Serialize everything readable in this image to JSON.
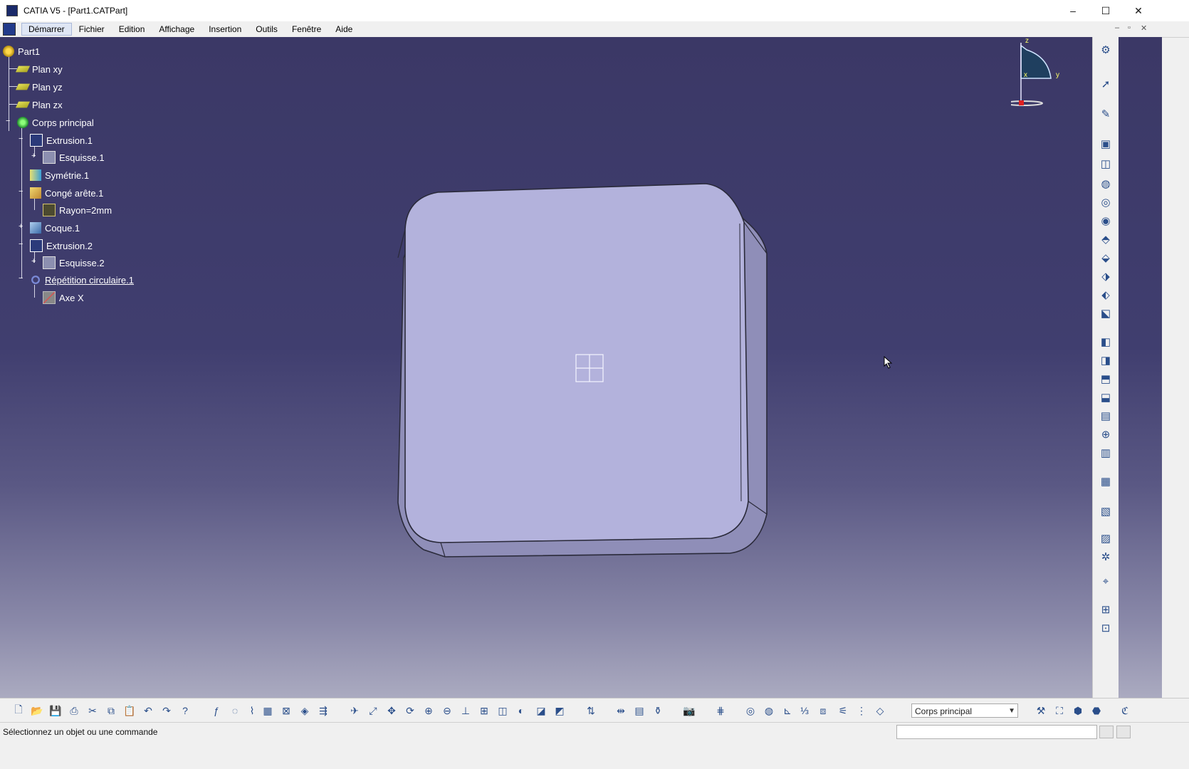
{
  "window": {
    "title": "CATIA V5 - [Part1.CATPart]",
    "minimize_icon": "minimize-icon",
    "maximize_icon": "maximize-icon",
    "close_icon": "close-icon"
  },
  "menu": {
    "items": [
      "Démarrer",
      "Fichier",
      "Edition",
      "Affichage",
      "Insertion",
      "Outils",
      "Fenêtre",
      "Aide"
    ],
    "active_index": 0
  },
  "tree": {
    "root": "Part1",
    "plane_xy": "Plan xy",
    "plane_yz": "Plan yz",
    "plane_zx": "Plan zx",
    "body": "Corps principal",
    "extrusion1": "Extrusion.1",
    "esquisse1": "Esquisse.1",
    "symetrie1": "Symétrie.1",
    "conge": "Congé arête.1",
    "rayon": "Rayon=2mm",
    "coque": "Coque.1",
    "extrusion2": "Extrusion.2",
    "esquisse2": "Esquisse.2",
    "repetition": "Répétition circulaire.1",
    "axe": "Axe X"
  },
  "compass": {
    "z": "z",
    "x": "x",
    "y": "y"
  },
  "mini_axis": {
    "z": "z",
    "y": "y"
  },
  "model": {
    "face_color": "#b3b2dc",
    "edge_color": "#2a2a3a"
  },
  "toolbar": {
    "current_body": "Corps principal"
  },
  "status": {
    "message": "Sélectionnez un objet ou une commande"
  },
  "colors": {
    "viewport_top": "#3b3866",
    "viewport_bottom": "#b7b7c9",
    "selection": "#dfe6f4"
  }
}
